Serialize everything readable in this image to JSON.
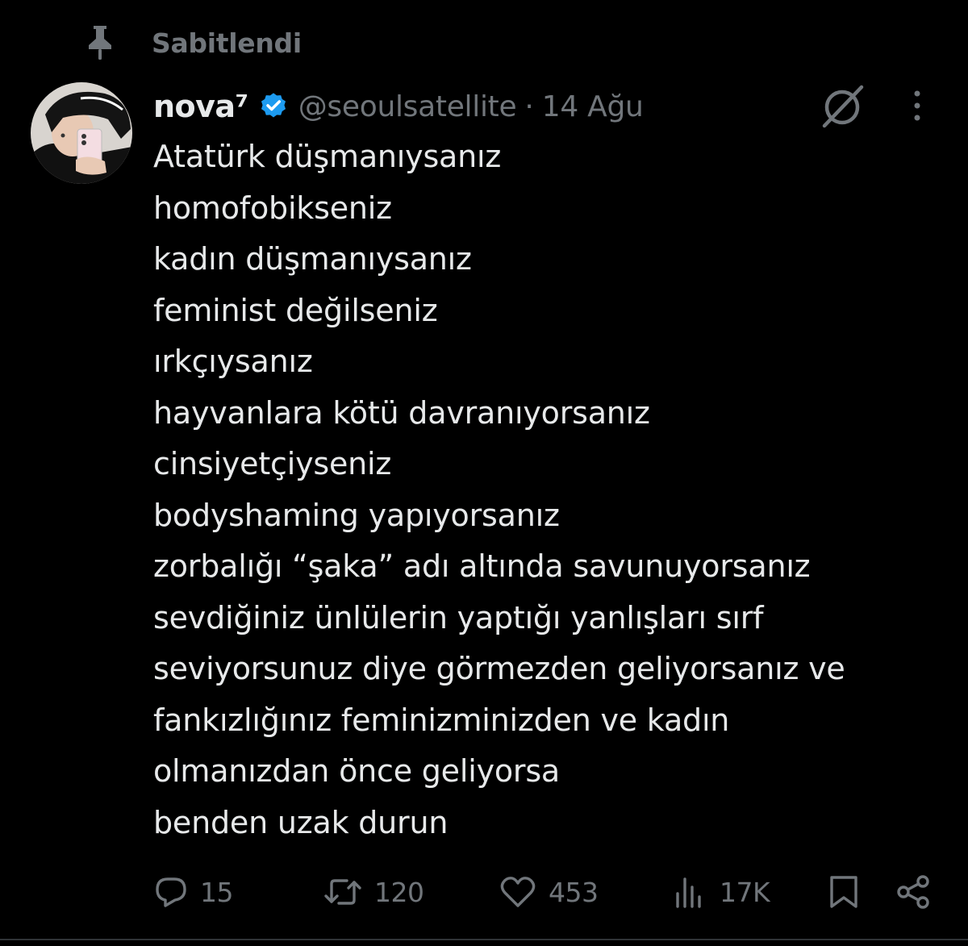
{
  "pinned": {
    "label": "Sabitlendi",
    "icon": "pin-icon"
  },
  "author": {
    "display_name": "nova⁷",
    "handle": "@seoulsatellite",
    "separator": "·",
    "date": "14 Ağu",
    "verified": true,
    "verified_color": "#1d9bf0"
  },
  "tweet": {
    "lines": [
      "Atatürk düşmanıysanız",
      "homofobikseniz",
      "kadın düşmanıysanız",
      "feminist değilseniz",
      "ırkçıysanız",
      "hayvanlara kötü davranıyorsanız",
      "cinsiyetçiyseniz",
      "bodyshaming yapıyorsanız",
      "zorbalığı “şaka” adı altında savunuyorsanız",
      "sevdiğiniz ünlülerin yaptığı yanlışları sırf",
      "seviyorsunuz diye görmezden geliyorsanız ve",
      "fankızlığınız feminizminizden ve kadın",
      "olmanızdan önce geliyorsa",
      "benden uzak durun"
    ]
  },
  "actions": {
    "replies": "15",
    "retweets": "120",
    "likes": "453",
    "views": "17K"
  },
  "colors": {
    "background": "#000000",
    "text": "#e7e9ea",
    "muted": "#71767b",
    "divider": "#2f3336",
    "accent": "#1d9bf0"
  },
  "icons": [
    "pin-icon",
    "verified-badge-icon",
    "grok-icon",
    "more-icon",
    "reply-icon",
    "retweet-icon",
    "like-icon",
    "views-icon",
    "bookmark-icon",
    "share-icon"
  ]
}
